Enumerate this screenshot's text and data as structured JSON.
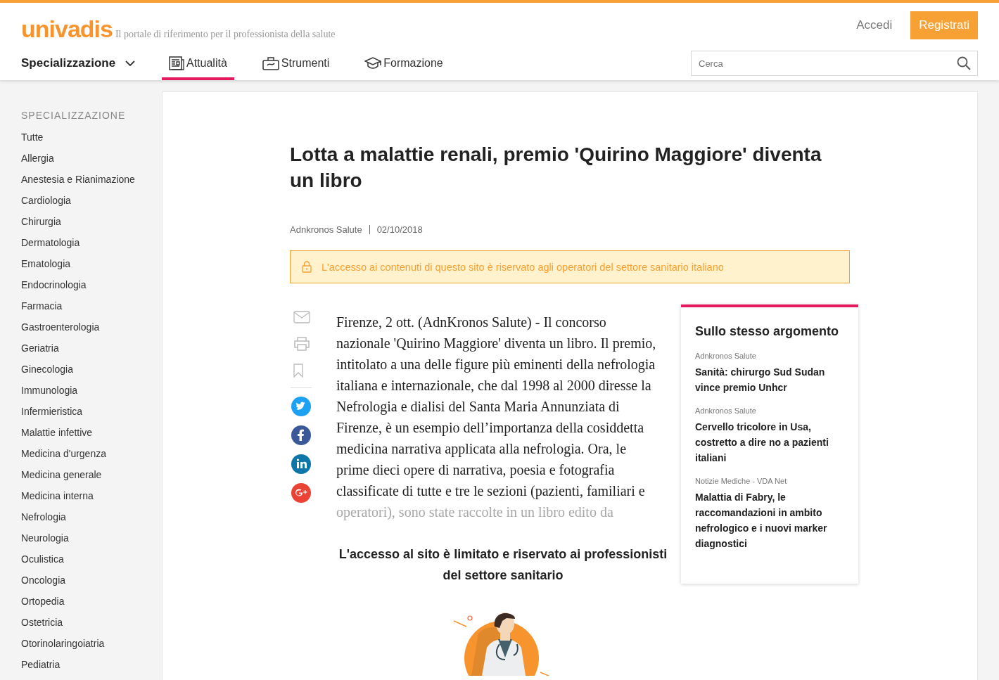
{
  "header": {
    "logo": "univadis",
    "tagline": "Il portale di riferimento per il professionista della salute",
    "login": "Accedi",
    "register": "Registrati",
    "specialty_menu": "Specializzazione",
    "search": {
      "placeholder": "Cerca"
    }
  },
  "tabs": [
    {
      "label": "Attualità",
      "kind": "news",
      "selected": true
    },
    {
      "label": "Strumenti",
      "kind": "tools",
      "selected": false
    },
    {
      "label": "Formazione",
      "kind": "education",
      "selected": false
    }
  ],
  "sidebar": {
    "heading": "SPECIALIZZAZIONE",
    "items": [
      "Tutte",
      "Allergia",
      "Anestesia e Rianimazione",
      "Cardiologia",
      "Chirurgia",
      "Dermatologia",
      "Ematologia",
      "Endocrinologia",
      "Farmacia",
      "Gastroenterologia",
      "Geriatria",
      "Ginecologia",
      "Immunologia",
      "Infermieristica",
      "Malattie infettive",
      "Medicina d'urgenza",
      "Medicina generale",
      "Medicina interna",
      "Nefrologia",
      "Neurologia",
      "Oculistica",
      "Oncologia",
      "Ortopedia",
      "Ostetricia",
      "Otorinolaringoiatria",
      "Pediatria"
    ]
  },
  "article": {
    "title": "Lotta a malattie renali, premio 'Quirino Maggiore' diventa un libro",
    "source": "Adnkronos Salute",
    "date": "02/10/2018",
    "notice": "L'accesso ai contenuti di questo sito è riservato agli operatori del settore sanitario italiano",
    "body": "Firenze, 2 ott. (AdnKronos Salute) - Il concorso nazionale 'Quirino Maggiore' diventa un libro. Il premio, intitolato a una delle figure più eminenti della nefrologia italiana e internazionale, che dal 1998 al 2000 diresse la Nefrologia e dialisi del Santa Maria Annunziata di Firenze, è un esempio dell’importanza della cosiddetta medicina narrativa applicata alla nefrologia. Ora, le prime dieci opere di narrativa, poesia e fotografia classificate di tutte e tre le sezioni (pazienti, familiari e",
    "body_faded": "operatori), sono state raccolte in un libro edito da",
    "share": [
      {
        "kind": "email"
      },
      {
        "kind": "print"
      },
      {
        "kind": "bookmark"
      },
      {
        "kind": "twitter"
      },
      {
        "kind": "facebook"
      },
      {
        "kind": "linkedin"
      },
      {
        "kind": "google"
      }
    ],
    "restricted": "L'accesso al sito è limitato e riservato ai professionisti del settore sanitario"
  },
  "related": {
    "heading": "Sullo stesso argomento",
    "items": [
      {
        "source": "Adnkronos Salute",
        "title": "Sanità: chirurgo Sud Sudan vince premio Unhcr"
      },
      {
        "source": "Adnkronos Salute",
        "title": "Cervello tricolore in Usa, costretto a dire no a pazienti italiani"
      },
      {
        "source": "Notizie Mediche - VDA Net",
        "title": "Malattia di Fabry, le raccomandazioni in ambito nefrologico e i nuovi marker diagnostici"
      }
    ]
  }
}
